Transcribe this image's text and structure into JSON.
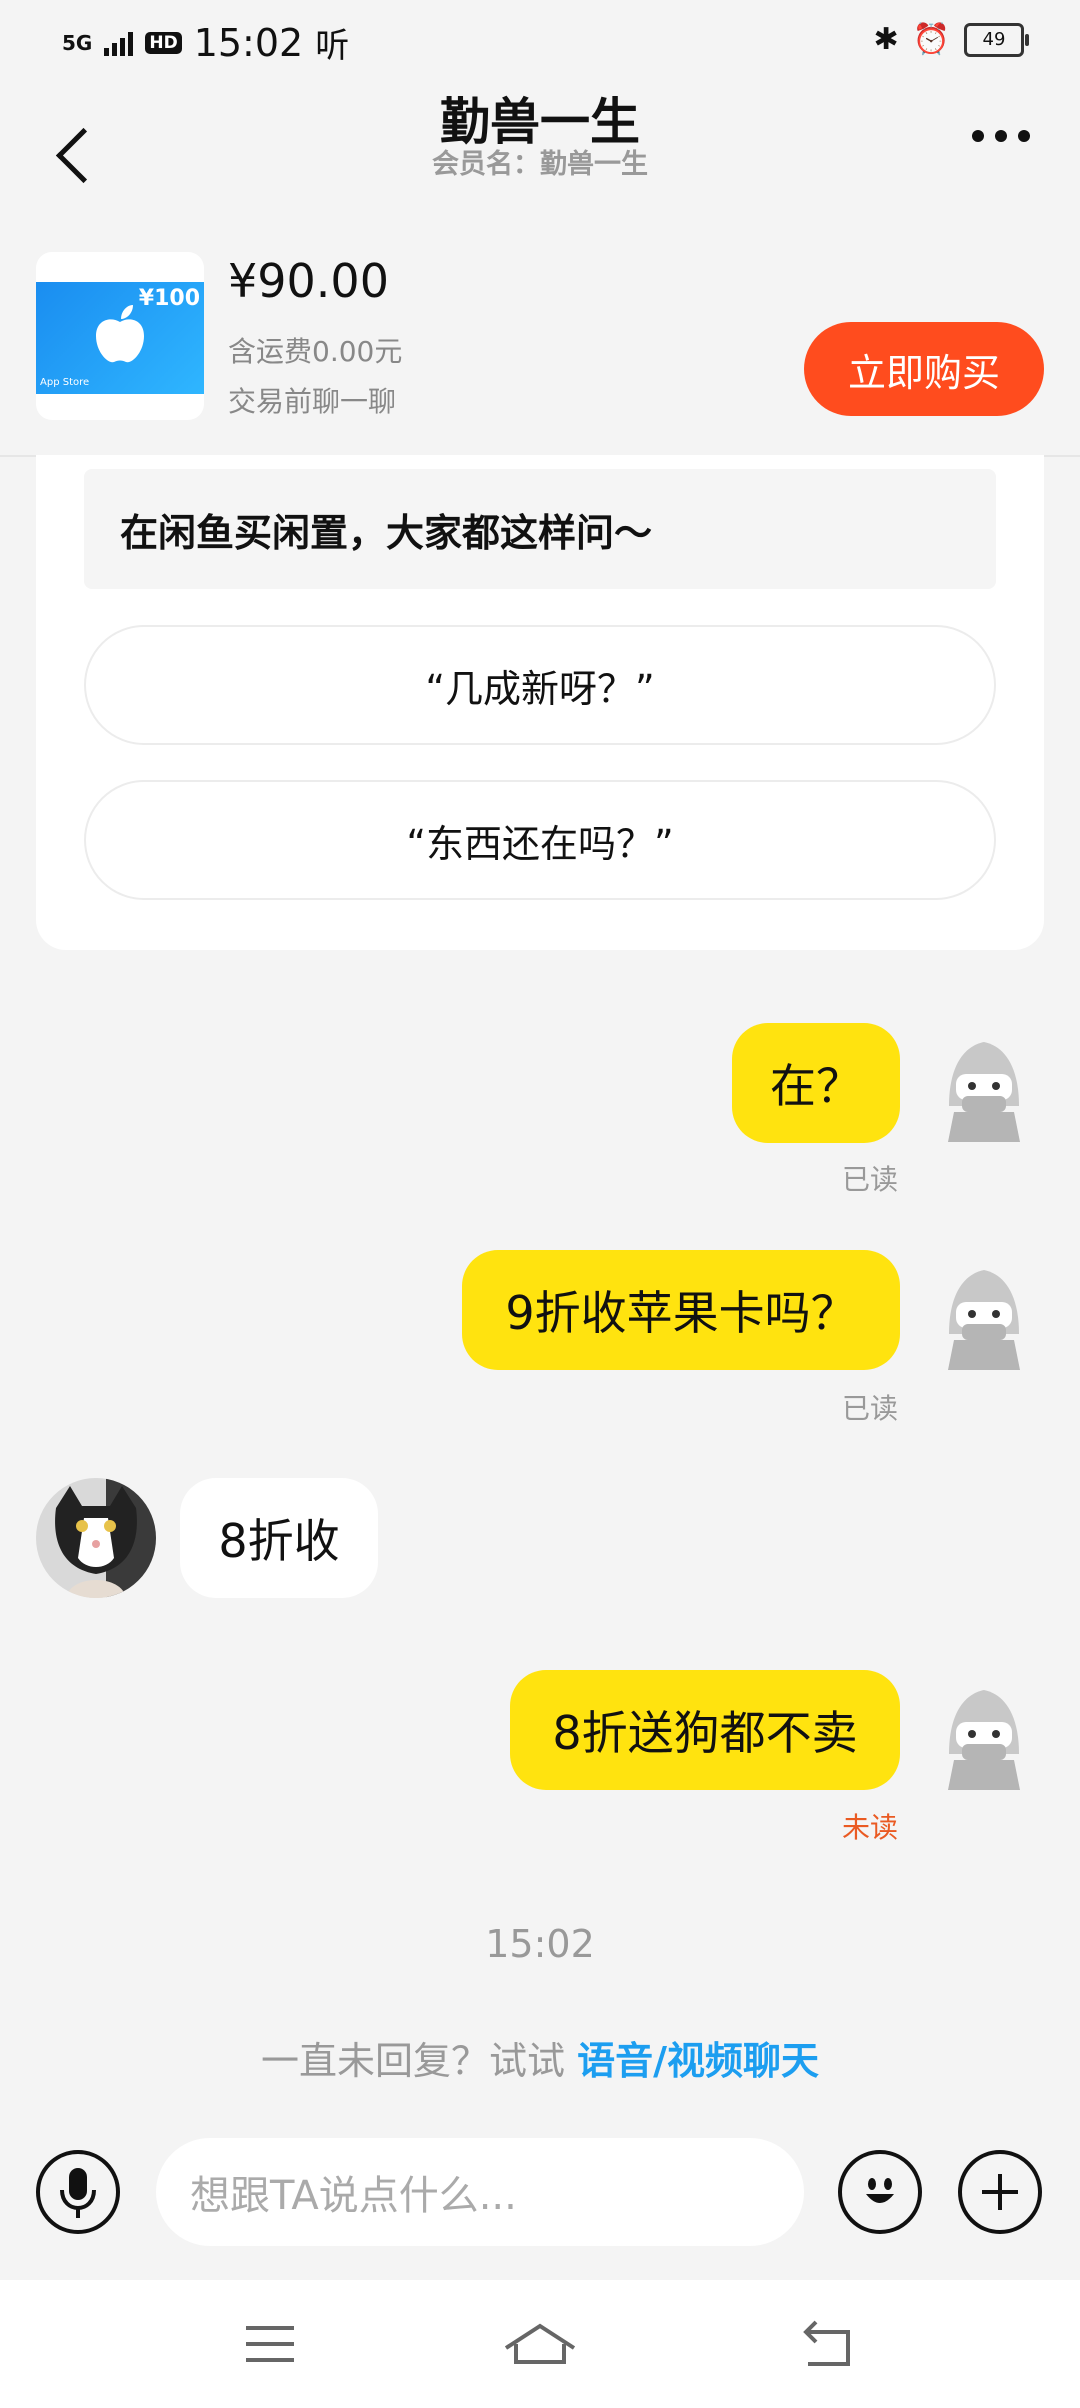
{
  "status_bar": {
    "network": "5G",
    "hd": "HD",
    "time": "15:02",
    "listen": "听",
    "battery": "49"
  },
  "header": {
    "title": "勤兽一生",
    "subtitle": "会员名：勤兽一生"
  },
  "product": {
    "price": "¥90.00",
    "shipping": "含运费0.00元",
    "chat_hint": "交易前聊一聊",
    "buy_label": "立即购买",
    "thumb_amount": "¥100",
    "thumb_store": "App Store"
  },
  "suggestions": {
    "heading": "在闲鱼买闲置，大家都这样问～",
    "questions": [
      "“几成新呀？”",
      "“东西还在吗？”"
    ]
  },
  "messages": [
    {
      "from": "me",
      "text": "在？",
      "status": "已读"
    },
    {
      "from": "me",
      "text": "9折收苹果卡吗？",
      "status": "已读"
    },
    {
      "from": "other",
      "text": "8折收"
    },
    {
      "from": "me",
      "text": "8折送狗都不卖",
      "status": "未读"
    }
  ],
  "timestamp": "15:02",
  "no_reply": {
    "prefix": "一直未回复？试试 ",
    "link": "语音/视频聊天"
  },
  "input": {
    "placeholder": "想跟TA说点什么..."
  },
  "colors": {
    "accent": "#ff4c1e",
    "my_bubble": "#ffe30f",
    "link": "#1c9ef0",
    "unread": "#ea5a22"
  }
}
